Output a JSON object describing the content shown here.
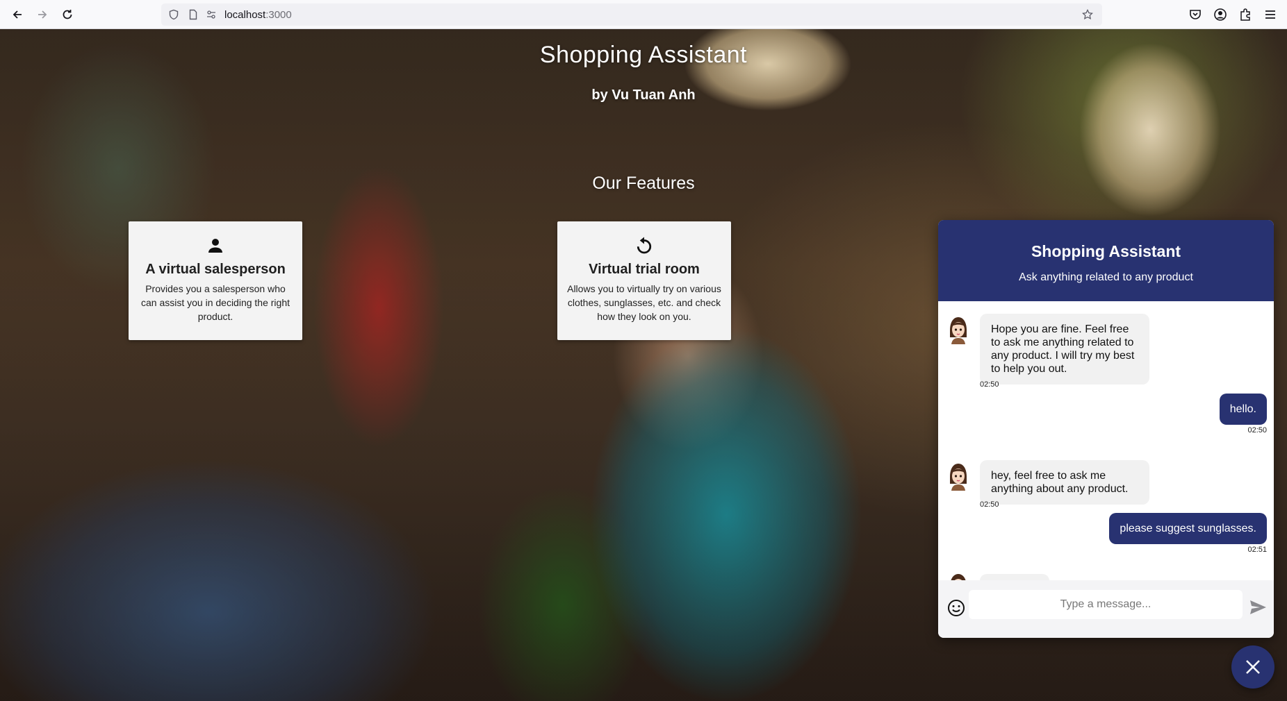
{
  "browser": {
    "url_host": "localhost",
    "url_port": ":3000"
  },
  "hero": {
    "title": "Shopping Assistant",
    "subtitle": "by Vu Tuan Anh",
    "features_heading": "Our Features"
  },
  "features": [
    {
      "icon": "person-icon",
      "title": "A virtual salesperson",
      "description": "Provides you a salesperson who can assist you in deciding the right product."
    },
    {
      "icon": "rotate-icon",
      "title": "Virtual trial room",
      "description": "Allows you to virtually try on various clothes, sunglasses, etc. and check how they look on you."
    }
  ],
  "chat": {
    "title": "Shopping Assistant",
    "subtitle": "Ask anything related to any product",
    "messages": [
      {
        "from": "bot",
        "text": "Hope you are fine. Feel free to ask me anything related to any product. I will try my best to help you out.",
        "time": "02:50"
      },
      {
        "from": "user",
        "text": "hello.",
        "time": "02:50"
      },
      {
        "from": "bot",
        "text": "hey, feel free to ask me anything about any product.",
        "time": "02:50"
      },
      {
        "from": "user",
        "text": "please suggest sunglasses.",
        "time": "02:51"
      }
    ],
    "input_placeholder": "Type a message...",
    "accent_color": "#283271"
  }
}
